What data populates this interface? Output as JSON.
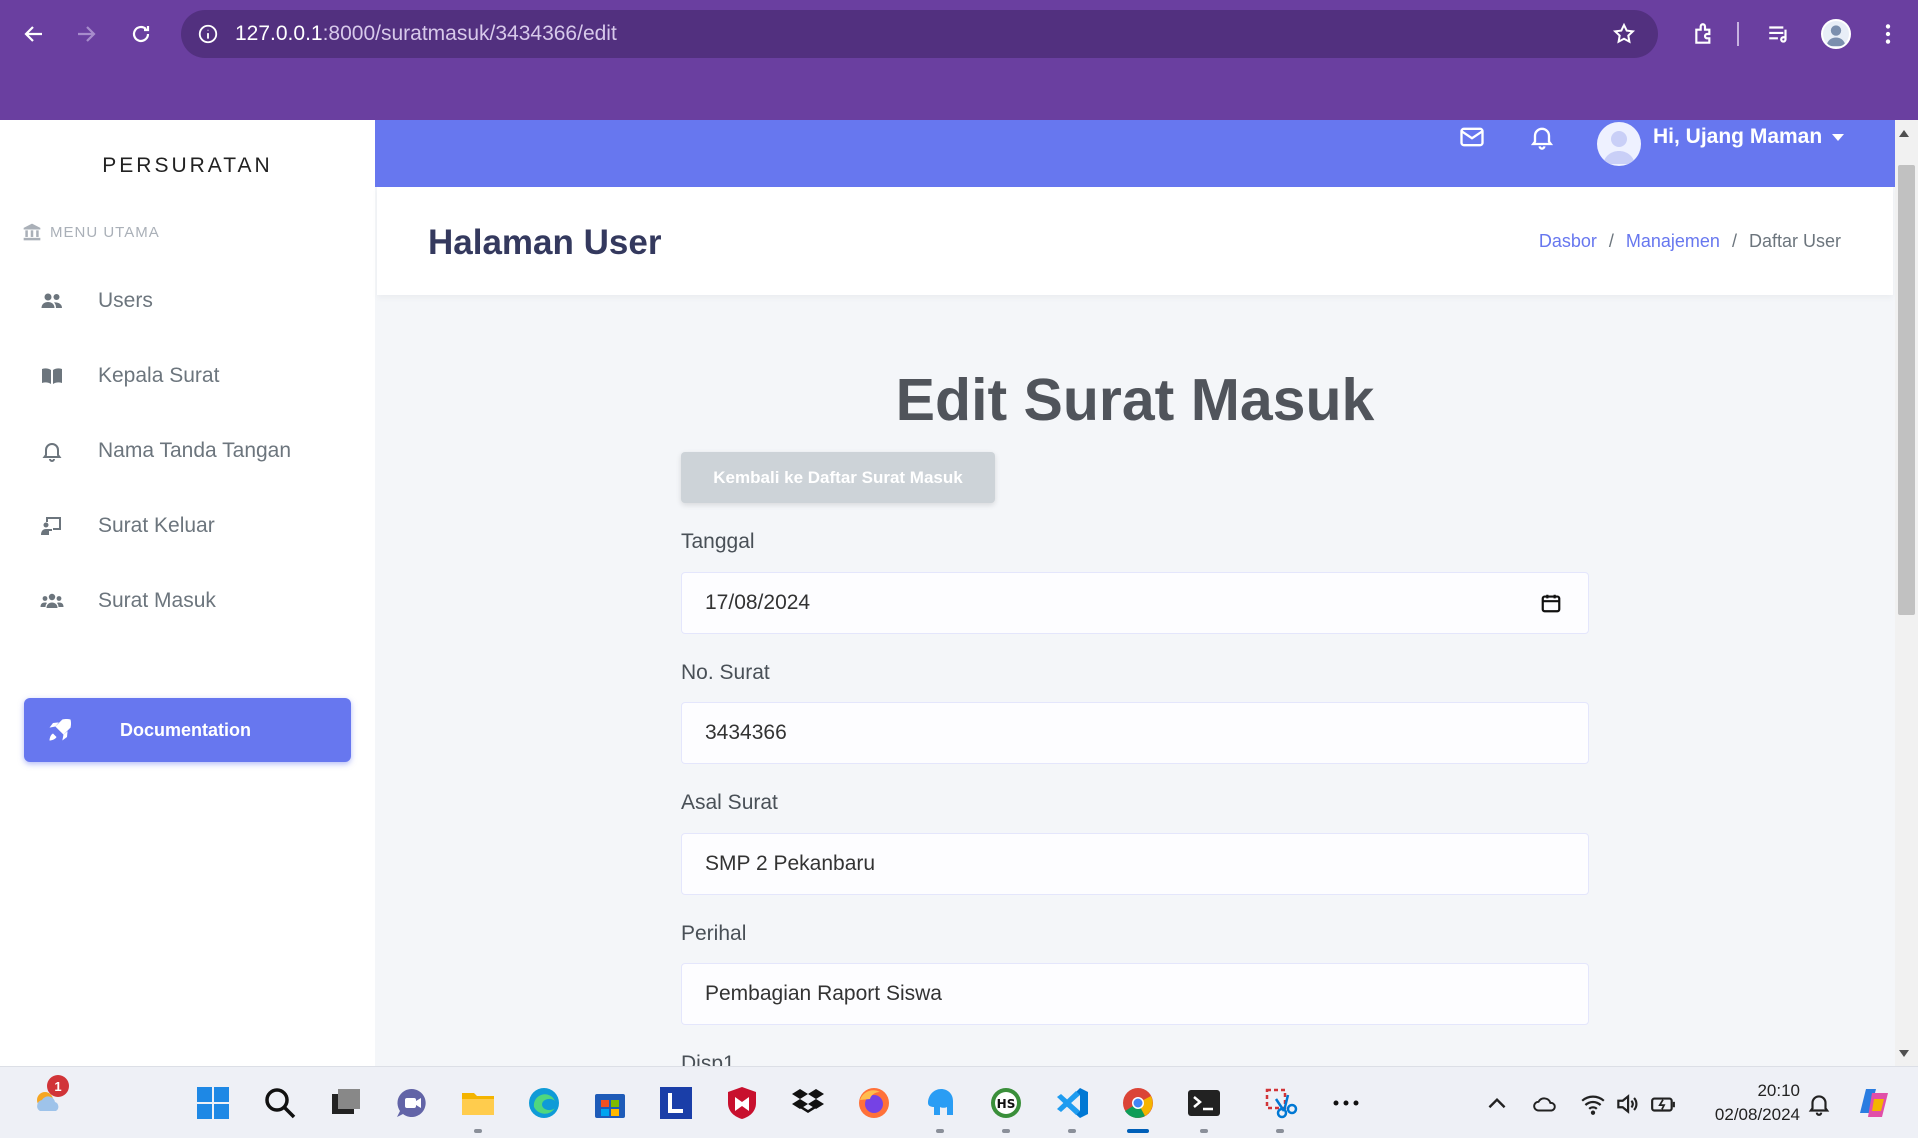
{
  "browser": {
    "url_host": "127.0.0.1",
    "url_path": ":8000/suratmasuk/3434366/edit"
  },
  "sidebar": {
    "brand": "PERSURATAN",
    "menu_header": "MENU UTAMA",
    "items": [
      {
        "label": "Users",
        "icon": "users-icon"
      },
      {
        "label": "Kepala Surat",
        "icon": "book-icon"
      },
      {
        "label": "Nama Tanda Tangan",
        "icon": "bell-icon"
      },
      {
        "label": "Surat Keluar",
        "icon": "chalkboard-icon"
      },
      {
        "label": "Surat Masuk",
        "icon": "user-group-icon"
      }
    ],
    "doc_button": "Documentation"
  },
  "navbar": {
    "user_greeting": "Hi, Ujang Maman"
  },
  "section": {
    "title": "Halaman User",
    "breadcrumb": [
      "Dasbor",
      "Manajemen",
      "Daftar User"
    ]
  },
  "form": {
    "heading": "Edit Surat Masuk",
    "back_button": "Kembali ke Daftar Surat Masuk",
    "fields": [
      {
        "label": "Tanggal",
        "value": "17/08/2024"
      },
      {
        "label": "No. Surat",
        "value": "3434366"
      },
      {
        "label": "Asal Surat",
        "value": "SMP 2 Pekanbaru"
      },
      {
        "label": "Perihal",
        "value": "Pembagian Raport Siswa"
      },
      {
        "label": "Disp1",
        "value": ""
      }
    ]
  },
  "taskbar": {
    "weather_badge": "1",
    "time": "20:10",
    "date": "02/08/2024"
  },
  "colors": {
    "browser_chrome": "#6a3fa0",
    "primary": "#6777ef",
    "heading_text": "#34395e"
  }
}
